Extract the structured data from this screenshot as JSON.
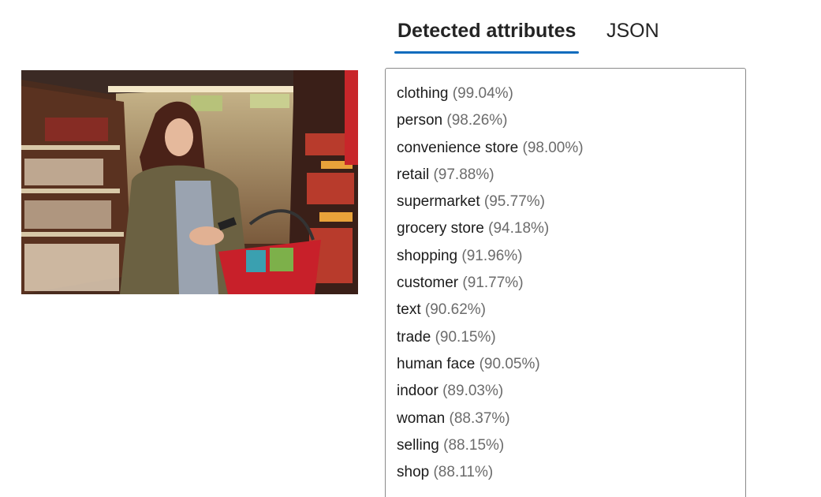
{
  "tabs": [
    {
      "label": "Detected attributes",
      "selected": true
    },
    {
      "label": "JSON",
      "selected": false
    }
  ],
  "accent_color": "#0f6cbd",
  "image": {
    "kind": "photo",
    "icon": "photo-of-woman-shopping-in-grocery-aisle"
  },
  "attributes": [
    {
      "name": "clothing",
      "confidence": "(99.04%)"
    },
    {
      "name": "person",
      "confidence": "(98.26%)"
    },
    {
      "name": "convenience store",
      "confidence": "(98.00%)"
    },
    {
      "name": "retail",
      "confidence": "(97.88%)"
    },
    {
      "name": "supermarket",
      "confidence": "(95.77%)"
    },
    {
      "name": "grocery store",
      "confidence": "(94.18%)"
    },
    {
      "name": "shopping",
      "confidence": "(91.96%)"
    },
    {
      "name": "customer",
      "confidence": "(91.77%)"
    },
    {
      "name": "text",
      "confidence": "(90.62%)"
    },
    {
      "name": "trade",
      "confidence": "(90.15%)"
    },
    {
      "name": "human face",
      "confidence": "(90.05%)"
    },
    {
      "name": "indoor",
      "confidence": "(89.03%)"
    },
    {
      "name": "woman",
      "confidence": "(88.37%)"
    },
    {
      "name": "selling",
      "confidence": "(88.15%)"
    },
    {
      "name": "shop",
      "confidence": "(88.11%)"
    }
  ]
}
